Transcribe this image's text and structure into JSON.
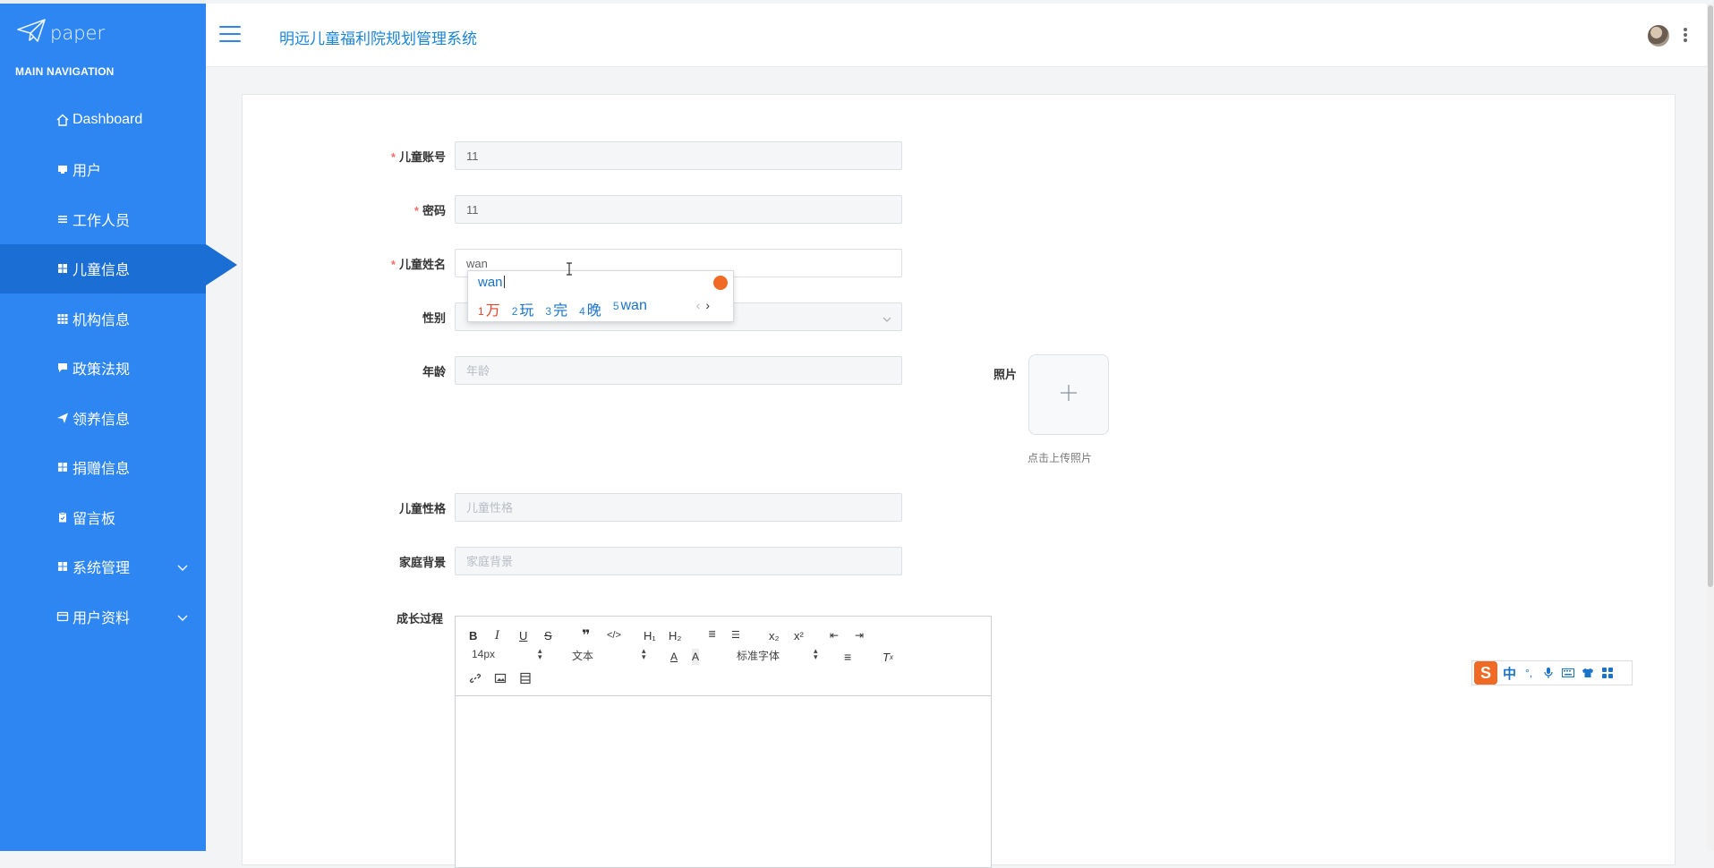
{
  "brand": {
    "name": "paper"
  },
  "sidebar": {
    "heading": "MAIN NAVIGATION",
    "items": [
      {
        "label": "Dashboard",
        "icon": "home-icon"
      },
      {
        "label": "用户",
        "icon": "monitor-icon"
      },
      {
        "label": "工作人员",
        "icon": "list-icon"
      },
      {
        "label": "儿童信息",
        "icon": "grid-icon",
        "active": true
      },
      {
        "label": "机构信息",
        "icon": "table-icon"
      },
      {
        "label": "政策法规",
        "icon": "comment-icon"
      },
      {
        "label": "领养信息",
        "icon": "send-icon"
      },
      {
        "label": "捐赠信息",
        "icon": "grid-icon"
      },
      {
        "label": "留言板",
        "icon": "clipboard-icon"
      },
      {
        "label": "系统管理",
        "icon": "grid-icon",
        "expandable": true
      },
      {
        "label": "用户资料",
        "icon": "card-icon",
        "expandable": true
      }
    ]
  },
  "header": {
    "title": "明远儿童福利院规划管理系统"
  },
  "form": {
    "account": {
      "label": "儿童账号",
      "value": "11"
    },
    "password": {
      "label": "密码",
      "value": "11"
    },
    "name": {
      "label": "儿童姓名",
      "value": "wan"
    },
    "gender": {
      "label": "性别",
      "placeholder": ""
    },
    "age": {
      "label": "年龄",
      "placeholder": "年龄"
    },
    "photo": {
      "label": "照片",
      "hint": "点击上传照片"
    },
    "personality": {
      "label": "儿童性格",
      "placeholder": "儿童性格"
    },
    "family": {
      "label": "家庭背景",
      "placeholder": "家庭背景"
    },
    "growth": {
      "label": "成长过程"
    }
  },
  "editor": {
    "font_size": "14px",
    "text_style": "文本",
    "font_family": "标准字体"
  },
  "ime": {
    "composition": "wan",
    "candidates": [
      {
        "n": "1",
        "text": "万"
      },
      {
        "n": "2",
        "text": "玩"
      },
      {
        "n": "3",
        "text": "完"
      },
      {
        "n": "4",
        "text": "晚"
      },
      {
        "n": "5",
        "text": "wan"
      }
    ]
  },
  "sogou_bar": {
    "logo": "S",
    "mode": "中"
  },
  "colors": {
    "sidebar": "#2e86f2",
    "sidebar_active": "#1a6ed4",
    "title": "#1a84d8",
    "required": "#f56c6c"
  }
}
